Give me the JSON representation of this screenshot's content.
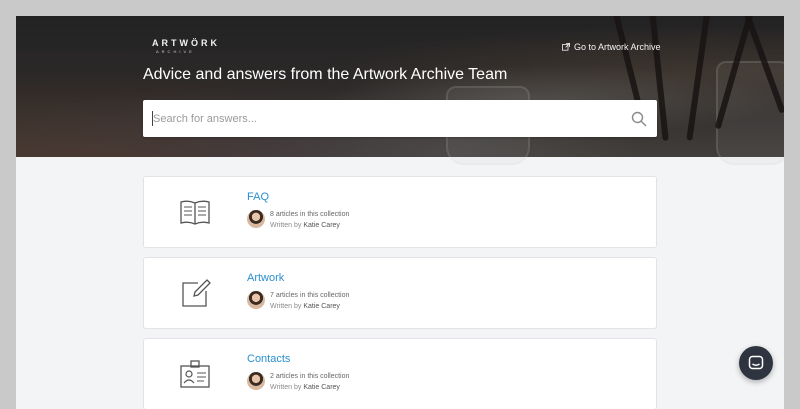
{
  "header": {
    "logo_text": "ARTWÖRK",
    "logo_subtext": "ARCHIVE",
    "goto_link": "Go to Artwork Archive",
    "title": "Advice and answers from the Artwork Archive Team"
  },
  "search": {
    "placeholder": "Search for answers...",
    "value": ""
  },
  "collections": [
    {
      "title": "FAQ",
      "count_text": "8 articles in this collection",
      "written_by": "Written by",
      "author": "Katie Carey",
      "icon": "open-book-icon"
    },
    {
      "title": "Artwork",
      "count_text": "7 articles in this collection",
      "written_by": "Written by",
      "author": "Katie Carey",
      "icon": "edit-square-icon"
    },
    {
      "title": "Contacts",
      "count_text": "2 articles in this collection",
      "written_by": "Written by",
      "author": "Katie Carey",
      "icon": "id-badge-icon"
    }
  ],
  "colors": {
    "accent_link": "#2a8fcf",
    "page_bg": "#f3f4f6",
    "chat_button": "#2f3540"
  },
  "chat": {
    "icon": "chat-bubble-icon"
  }
}
